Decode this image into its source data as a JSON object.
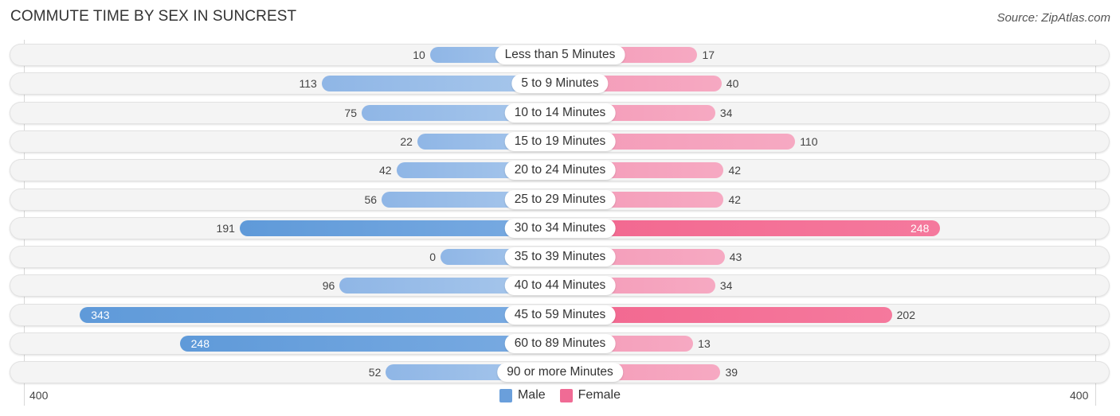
{
  "title": "COMMUTE TIME BY SEX IN SUNCREST",
  "source": "Source: ZipAtlas.com",
  "colors": {
    "male": "#6a9fdb",
    "female": "#f06b95"
  },
  "chart_data": {
    "type": "bar",
    "orientation": "horizontal-diverging",
    "title": "COMMUTE TIME BY SEX IN SUNCREST",
    "categories": [
      "Less than 5 Minutes",
      "5 to 9 Minutes",
      "10 to 14 Minutes",
      "15 to 19 Minutes",
      "20 to 24 Minutes",
      "25 to 29 Minutes",
      "30 to 34 Minutes",
      "35 to 39 Minutes",
      "40 to 44 Minutes",
      "45 to 59 Minutes",
      "60 to 89 Minutes",
      "90 or more Minutes"
    ],
    "series": [
      {
        "name": "Male",
        "values": [
          10,
          113,
          75,
          22,
          42,
          56,
          191,
          0,
          96,
          343,
          248,
          52
        ]
      },
      {
        "name": "Female",
        "values": [
          17,
          40,
          34,
          110,
          42,
          42,
          248,
          43,
          34,
          202,
          13,
          39
        ]
      }
    ],
    "axis_min_label": "400",
    "axis_max_label": "400",
    "xlim": [
      -400,
      400
    ],
    "legend": [
      "Male",
      "Female"
    ],
    "legend_position": "bottom-center"
  }
}
